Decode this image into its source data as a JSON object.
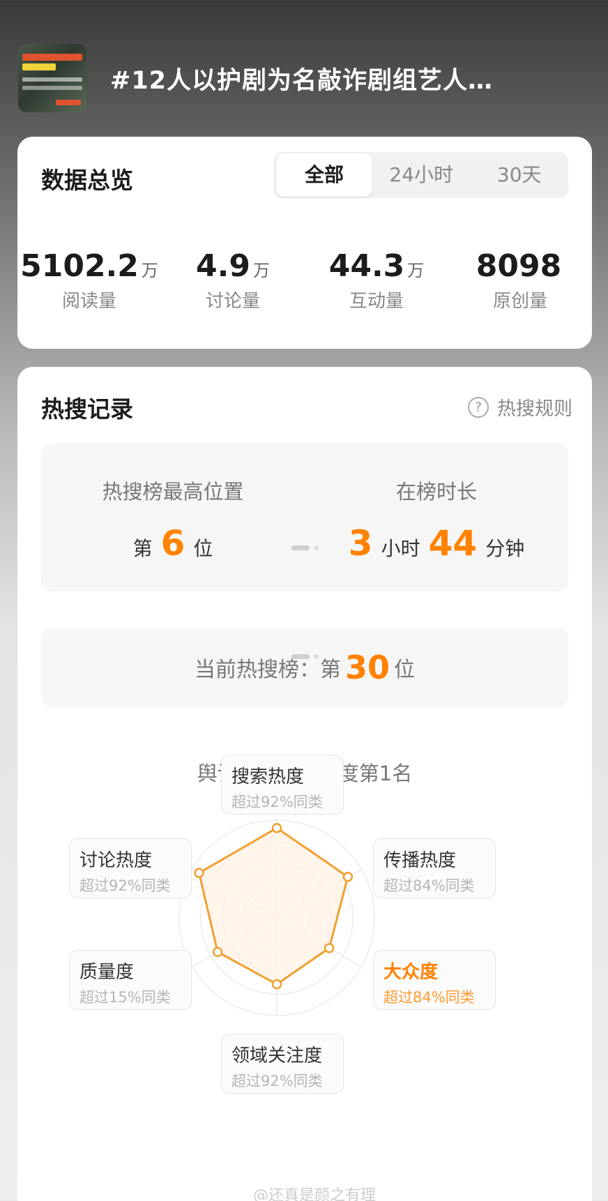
{
  "header": {
    "title": "#12人以护剧为名敲诈剧组艺人…"
  },
  "overview": {
    "title": "数据总览",
    "tabs": [
      "全部",
      "24小时",
      "30天"
    ],
    "active_tab": "全部",
    "stats": [
      {
        "value": "5102.2",
        "unit": "万",
        "label": "阅读量"
      },
      {
        "value": "4.9",
        "unit": "万",
        "label": "讨论量"
      },
      {
        "value": "44.3",
        "unit": "万",
        "label": "互动量"
      },
      {
        "value": "8098",
        "unit": "",
        "label": "原创量"
      }
    ]
  },
  "hot_search": {
    "title": "热搜记录",
    "rules_label": "热搜规则",
    "rules_icon": "help-circle-icon",
    "peak": {
      "label": "热搜榜最高位置",
      "prefix": "第",
      "value": "6",
      "suffix": "位"
    },
    "duration": {
      "label": "在榜时长",
      "hours": "3",
      "hours_unit": "小时",
      "minutes": "44",
      "minutes_unit": "分钟"
    },
    "current": {
      "label": "当前热搜榜：",
      "prefix": "第",
      "value": "30",
      "suffix": "位"
    },
    "domain_rank": "舆论监督领域热度第1名",
    "accent_color": "#ff8200"
  },
  "radar": {
    "dimensions": [
      {
        "name": "搜索热度",
        "percent": "超过92%同类",
        "value": 0.92,
        "highlight": false
      },
      {
        "name": "传播热度",
        "percent": "超过84%同类",
        "value": 0.84,
        "highlight": false
      },
      {
        "name": "大众度",
        "percent": "超过84%同类",
        "value": 0.62,
        "highlight": true
      },
      {
        "name": "领域关注度",
        "percent": "超过92%同类",
        "value": 0.68,
        "highlight": false
      },
      {
        "name": "质量度",
        "percent": "超过15%同类",
        "value": 0.7,
        "highlight": false
      },
      {
        "name": "讨论热度",
        "percent": "超过92%同类",
        "value": 0.92,
        "highlight": false
      }
    ]
  },
  "watermark": "@还真是颜之有理"
}
